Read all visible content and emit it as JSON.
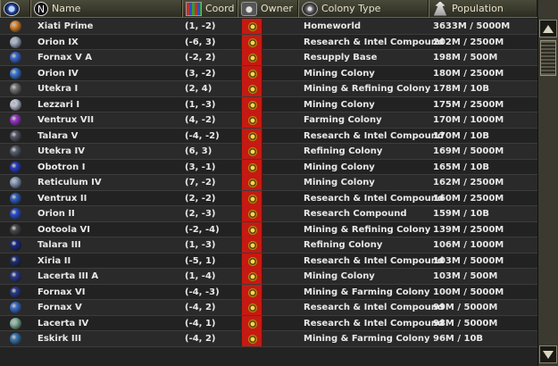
{
  "header": {
    "eye_label": "",
    "name_label": "Name",
    "coord_label": "Coord",
    "owner_label": "Owner",
    "colony_label": "Colony Type",
    "pop_label": "Population"
  },
  "owner_color": "#c41a12",
  "planets": [
    {
      "name": "Xiati Prime",
      "coord": "(1, -2)",
      "colony": "Homeworld",
      "pop": "3633M / 5000M",
      "color": "#e08a30"
    },
    {
      "name": "Orion IX",
      "coord": "(-6, 3)",
      "colony": "Research & Intel Compound",
      "pop": "202M / 2500M",
      "color": "#a8b4c8"
    },
    {
      "name": "Fornax V A",
      "coord": "(-2, 2)",
      "colony": "Resupply Base",
      "pop": "198M / 500M",
      "color": "#3a6ad0"
    },
    {
      "name": "Orion IV",
      "coord": "(3, -2)",
      "colony": "Mining Colony",
      "pop": "180M / 2500M",
      "color": "#3c7ad8"
    },
    {
      "name": "Utekra I",
      "coord": "(2, 4)",
      "colony": "Mining & Refining Colony",
      "pop": "178M / 10B",
      "color": "#777777"
    },
    {
      "name": "Lezzari I",
      "coord": "(1, -3)",
      "colony": "Mining Colony",
      "pop": "175M / 2500M",
      "color": "#c0c8d8"
    },
    {
      "name": "Ventrux VII",
      "coord": "(4, -2)",
      "colony": "Farming Colony",
      "pop": "170M / 1000M",
      "color": "#9a38c8"
    },
    {
      "name": "Talara V",
      "coord": "(-4, -2)",
      "colony": "Research & Intel Compound",
      "pop": "170M / 10B",
      "color": "#555a66"
    },
    {
      "name": "Utekra IV",
      "coord": "(6, 3)",
      "colony": "Refining Colony",
      "pop": "169M / 5000M",
      "color": "#5a6270"
    },
    {
      "name": "Obotron I",
      "coord": "(3, -1)",
      "colony": "Mining Colony",
      "pop": "165M / 10B",
      "color": "#2a3ec0"
    },
    {
      "name": "Reticulum IV",
      "coord": "(7, -2)",
      "colony": "Mining Colony",
      "pop": "162M / 2500M",
      "color": "#8aa0c0"
    },
    {
      "name": "Ventrux II",
      "coord": "(2, -2)",
      "colony": "Research & Intel Compound",
      "pop": "160M / 2500M",
      "color": "#3060c0"
    },
    {
      "name": "Orion II",
      "coord": "(2, -3)",
      "colony": "Research Compound",
      "pop": "159M / 10B",
      "color": "#2a50d0"
    },
    {
      "name": "Ootoola VI",
      "coord": "(-2, -4)",
      "colony": "Mining & Refining Colony",
      "pop": "139M / 2500M",
      "color": "#4a4a50"
    },
    {
      "name": "Talara III",
      "coord": "(1, -3)",
      "colony": "Refining Colony",
      "pop": "106M / 1000M",
      "color": "#1a2a80"
    },
    {
      "name": "Xiria II",
      "coord": "(-5, 1)",
      "colony": "Research & Intel Compound",
      "pop": "103M / 5000M",
      "color": "#203070"
    },
    {
      "name": "Lacerta III A",
      "coord": "(1, -4)",
      "colony": "Mining Colony",
      "pop": "103M / 500M",
      "color": "#2a3a90"
    },
    {
      "name": "Fornax VI",
      "coord": "(-4, -3)",
      "colony": "Mining & Farming Colony",
      "pop": "100M / 5000M",
      "color": "#2a3a88"
    },
    {
      "name": "Fornax V",
      "coord": "(-4, 2)",
      "colony": "Research & Intel Compound",
      "pop": "99M / 5000M",
      "color": "#3a70d0"
    },
    {
      "name": "Lacerta IV",
      "coord": "(-4, 1)",
      "colony": "Research & Intel Compound",
      "pop": "98M / 5000M",
      "color": "#8ab8a0"
    },
    {
      "name": "Eskirk III",
      "coord": "(-4, 2)",
      "colony": "Mining & Farming Colony",
      "pop": "96M / 10B",
      "color": "#3a7ab8"
    }
  ]
}
